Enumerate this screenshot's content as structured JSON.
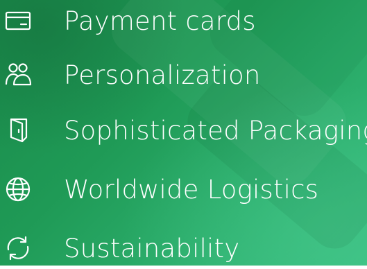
{
  "features": [
    {
      "label": "Payment cards",
      "icon": "payment-card-icon"
    },
    {
      "label": "Personalization",
      "icon": "people-icon"
    },
    {
      "label": "Sophisticated Packaging",
      "icon": "packaging-icon"
    },
    {
      "label": "Worldwide Logistics",
      "icon": "globe-icon"
    },
    {
      "label": "Sustainability",
      "icon": "recycle-arrows-icon"
    }
  ],
  "colors": {
    "background_dark": "#1a8a4a",
    "background_light": "#3cc184",
    "text": "#ffffff"
  }
}
